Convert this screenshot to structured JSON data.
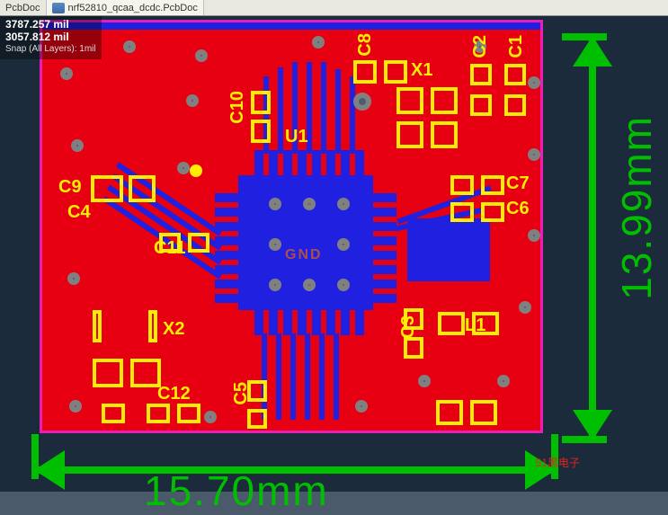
{
  "tabs": {
    "inactive_label": "PcbDoc",
    "active_label": "nrf52810_qcaa_dcdc.PcbDoc"
  },
  "coords": {
    "x": "3787.257 mil",
    "y": "3057.812 mil",
    "snap": "Snap (All Layers): 1mil"
  },
  "dimensions": {
    "width_label": "15.70mm",
    "height_label": "13.99mm"
  },
  "designators": {
    "C1": "C1",
    "C2": "C2",
    "C3": "C3",
    "C4": "C4",
    "C5": "C5",
    "C6": "C6",
    "C7": "C7",
    "C8": "C8",
    "C9": "C9",
    "C10": "C10",
    "C11": "C11",
    "C12": "C12",
    "L1": "L1",
    "U1": "U1",
    "X1": "X1",
    "X2": "X2"
  },
  "silk": {
    "gnd": "GND"
  },
  "watermark": "51黑电子"
}
